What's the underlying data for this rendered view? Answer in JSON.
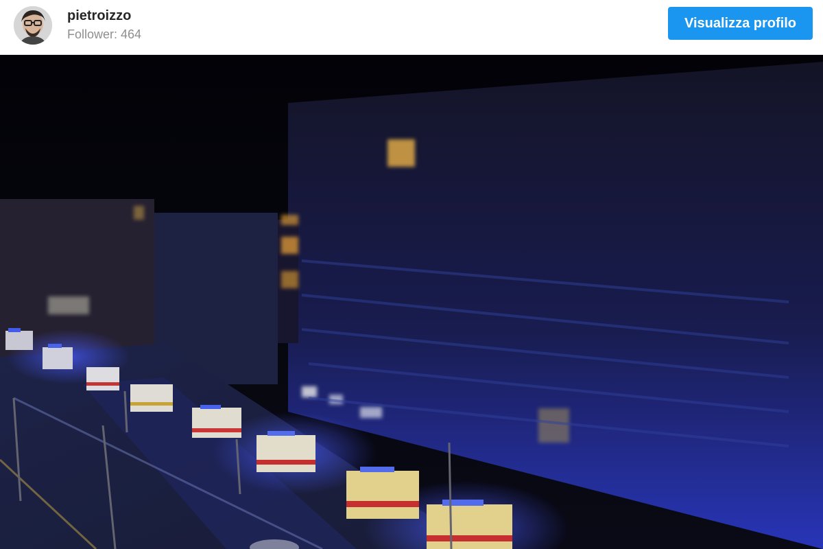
{
  "profile": {
    "username": "pietroizzo",
    "followers": "Follower: 464",
    "avatar_icon": "profile-photo"
  },
  "actions": {
    "view_profile": "Visualizza profilo"
  },
  "colors": {
    "primary": "#1a95f0",
    "text": "#262626",
    "muted": "#8e8e8e",
    "emergency_blue": "#2a3cff",
    "ambulance_yellow": "#f6d23a"
  }
}
